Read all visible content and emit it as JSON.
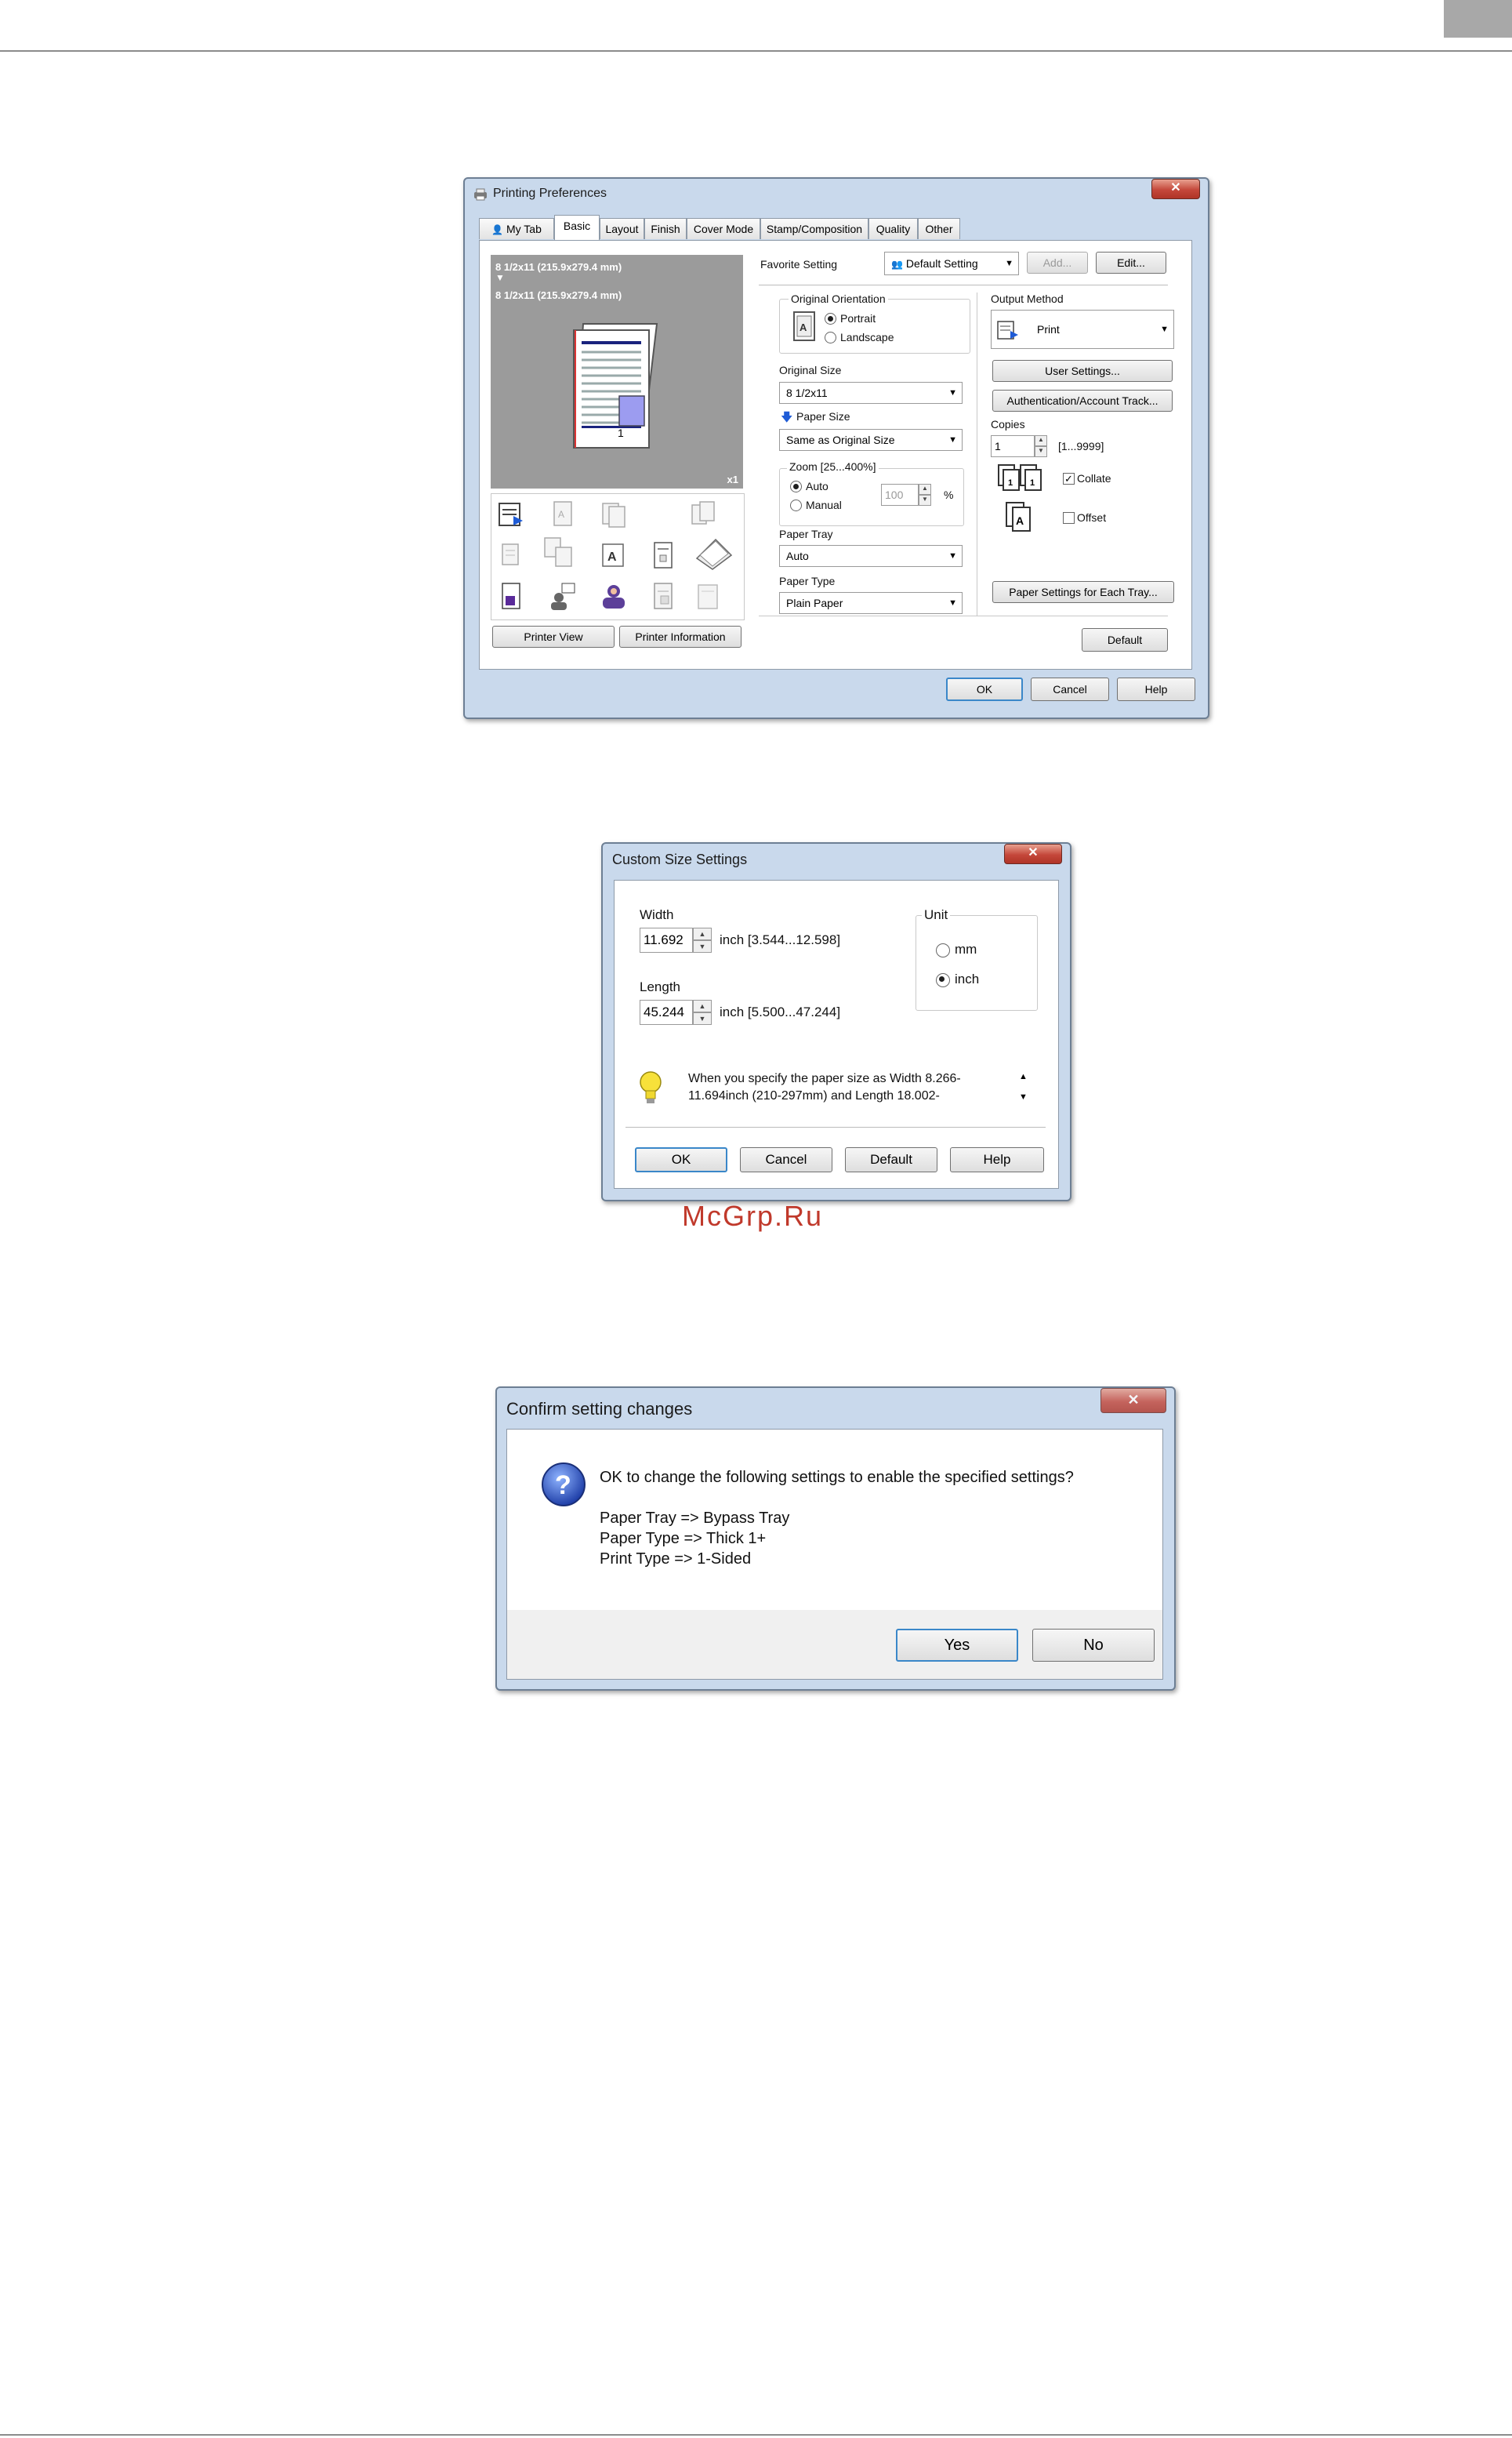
{
  "printing_preferences": {
    "title": "Printing Preferences",
    "tabs": [
      "My Tab",
      "Basic",
      "Layout",
      "Finish",
      "Cover Mode",
      "Stamp/Composition",
      "Quality",
      "Other"
    ],
    "preview": {
      "size_line1": "8 1/2x11 (215.9x279.4 mm)",
      "arrow": "▼",
      "size_line2": "8 1/2x11 (215.9x279.4 mm)",
      "copies_badge": "x1"
    },
    "printer_view_button": "Printer View",
    "printer_info_button": "Printer Information",
    "favorite_setting_label": "Favorite Setting",
    "favorite_setting_value": "Default Setting",
    "add_button": "Add...",
    "edit_button": "Edit...",
    "original_orientation_label": "Original Orientation",
    "portrait_label": "Portrait",
    "landscape_label": "Landscape",
    "original_size_label": "Original Size",
    "original_size_value": "8 1/2x11",
    "paper_size_label": "Paper Size",
    "paper_size_value": "Same as Original Size",
    "zoom_label": "Zoom [25...400%]",
    "zoom_auto_label": "Auto",
    "zoom_manual_label": "Manual",
    "zoom_value": "100",
    "zoom_unit": "%",
    "paper_tray_label": "Paper Tray",
    "paper_tray_value": "Auto",
    "paper_type_label": "Paper Type",
    "paper_type_value": "Plain Paper",
    "output_method_label": "Output Method",
    "output_method_value": "Print",
    "user_settings_button": "User Settings...",
    "auth_button": "Authentication/Account Track...",
    "copies_label": "Copies",
    "copies_value": "1",
    "copies_range": "[1...9999]",
    "collate_label": "Collate",
    "offset_label": "Offset",
    "paper_settings_button": "Paper Settings for Each Tray...",
    "default_button": "Default",
    "ok_button": "OK",
    "cancel_button": "Cancel",
    "help_button": "Help"
  },
  "custom_size": {
    "title": "Custom Size Settings",
    "width_label": "Width",
    "width_value": "11.692",
    "width_range": "inch [3.544...12.598]",
    "length_label": "Length",
    "length_value": "45.244",
    "length_range": "inch [5.500...47.244]",
    "unit_label": "Unit",
    "unit_mm": "mm",
    "unit_inch": "inch",
    "hint_line1": "When you specify the paper size as Width 8.266-",
    "hint_line2": "11.694inch (210-297mm) and Length 18.002-",
    "ok_button": "OK",
    "cancel_button": "Cancel",
    "default_button": "Default",
    "help_button": "Help"
  },
  "watermark": "McGrp.Ru",
  "confirm": {
    "title": "Confirm setting changes",
    "question": "OK to change the following settings to enable the specified settings?",
    "line1": "Paper Tray => Bypass Tray",
    "line2": "Paper Type => Thick 1+",
    "line3": "Print Type => 1-Sided",
    "yes_button": "Yes",
    "no_button": "No"
  },
  "colors": {
    "accent": "#3a87c9",
    "watermark": "#c0392b",
    "preview_bg": "#9b9b9b"
  }
}
